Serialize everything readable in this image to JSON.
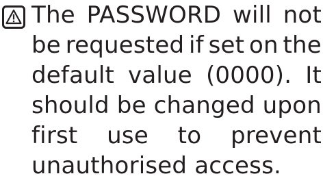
{
  "note": {
    "icon": "warning-icon",
    "lines": [
      [
        "The",
        "PASSWORD",
        "will",
        "not"
      ],
      [
        "be",
        "requested",
        "if",
        "set",
        "on",
        "the"
      ],
      [
        "default",
        "value",
        "(0000).",
        "It"
      ],
      [
        "should",
        "be",
        "changed",
        "upon"
      ],
      [
        "first",
        "use",
        "to",
        "prevent"
      ],
      [
        "unauthorised access."
      ]
    ]
  }
}
